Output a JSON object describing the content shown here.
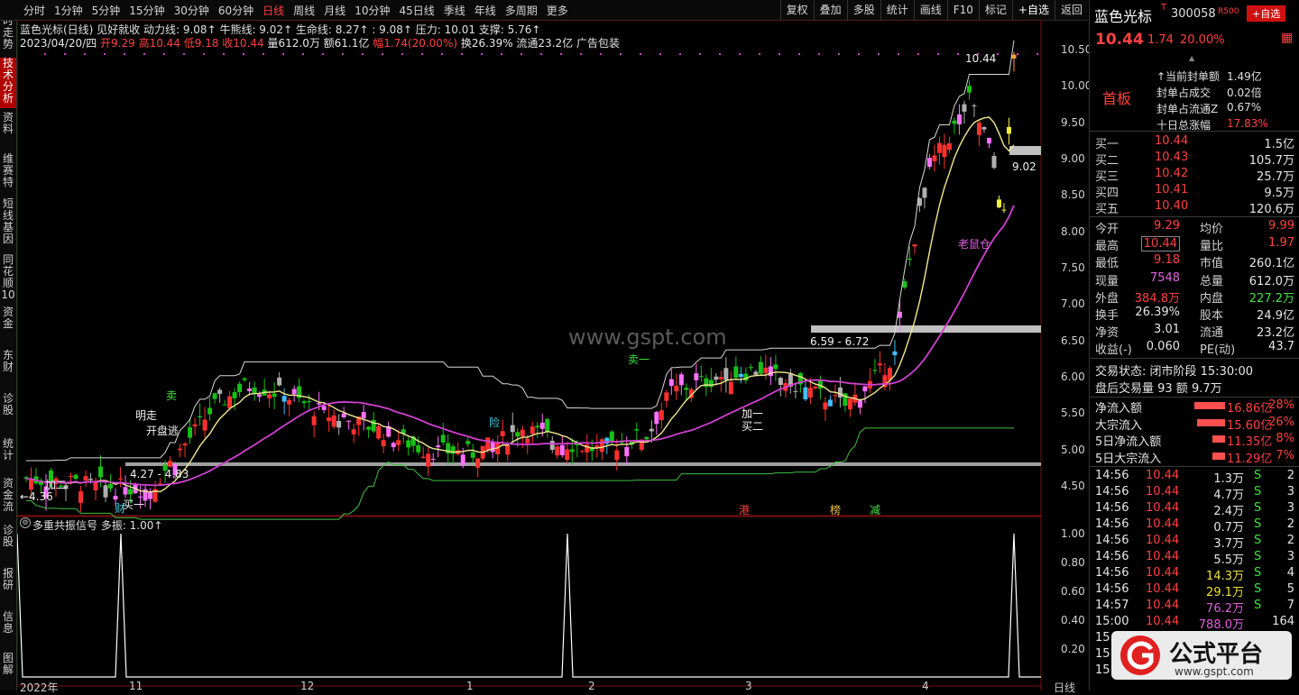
{
  "toolbar": {
    "periods": [
      "分时",
      "1分钟",
      "5分钟",
      "15分钟",
      "30分钟",
      "60分钟",
      "日线",
      "周线",
      "月线",
      "10分钟",
      "45日线",
      "季线",
      "年线",
      "多周期",
      "更多"
    ],
    "active_period": "日线",
    "right_buttons": [
      "复权",
      "叠加",
      "多股",
      "统计",
      "画线",
      "F10",
      "标记",
      "+自选",
      "返回"
    ]
  },
  "left_tabs": [
    "分时走势",
    "技术分析",
    "资料",
    "维赛特",
    "短线基因",
    "同花顺10",
    "资金",
    "东财",
    "诊股",
    "统计",
    "资金流",
    "诊股",
    "报研",
    "信息",
    "图解"
  ],
  "info": {
    "line1": "蓝色光标(日线)  见好就收  动力线: 9.08↑  牛熊线: 9.02↑  生命线: 8.27↑  : 9.08↑  压力: 10.01  支撑: 5.76↑",
    "line2_parts": [
      {
        "t": "2023/04/20/四",
        "c": "wht"
      },
      {
        "t": " 开9.29",
        "c": "red"
      },
      {
        "t": " 高10.44",
        "c": "red"
      },
      {
        "t": " 低9.18",
        "c": "red"
      },
      {
        "t": " 收10.44",
        "c": "red"
      },
      {
        "t": " 量612.0万",
        "c": "wht"
      },
      {
        "t": " 额61.1亿",
        "c": "wht"
      },
      {
        "t": " 幅1.74(20.00%)",
        "c": "red"
      },
      {
        "t": " 换26.39%",
        "c": "wht"
      },
      {
        "t": " 流通23.2亿",
        "c": "wht"
      },
      {
        "t": " 广告包装",
        "c": "wht"
      }
    ],
    "indicator2": "多重共振信号  多振: 1.00↑"
  },
  "y_axis_main": [
    "10.50",
    "10.00",
    "9.50",
    "9.00",
    "8.50",
    "8.00",
    "7.50",
    "7.00",
    "6.50",
    "6.00",
    "5.50",
    "5.00",
    "4.50"
  ],
  "y_axis_sub": [
    "1.00",
    "0.80",
    "0.60",
    "0.40",
    "0.20"
  ],
  "x_axis": [
    "2022年",
    "11",
    "12",
    "1",
    "2",
    "3",
    "4"
  ],
  "x_axis_end": "日线",
  "watermark": "www.gspt.com",
  "annotations": [
    {
      "t": "10.44",
      "c": "wht"
    },
    {
      "t": "9.02",
      "c": "wht"
    },
    {
      "t": "6.59 - 6.72",
      "c": "wht"
    },
    {
      "t": "4.27 - 4.83",
      "c": "wht"
    },
    {
      "t": "←4.36",
      "c": "wht"
    },
    {
      "t": "明走",
      "c": "wht"
    },
    {
      "t": "开盘逃",
      "c": "wht"
    },
    {
      "t": "加二",
      "c": "wht"
    },
    {
      "t": "买一",
      "c": "wht"
    },
    {
      "t": "买二",
      "c": "wht"
    },
    {
      "t": "卖",
      "c": "grn"
    },
    {
      "t": "卖一",
      "c": "grn"
    },
    {
      "t": "险",
      "c": "cyn"
    },
    {
      "t": "加一",
      "c": "wht"
    },
    {
      "t": "老鼠仓",
      "c": "mag"
    },
    {
      "t": "财",
      "c": "cyn"
    },
    {
      "t": "港",
      "c": "red"
    },
    {
      "t": "榜",
      "c": "yel"
    },
    {
      "t": "减",
      "c": "grn"
    }
  ],
  "right_panel": {
    "name": "蓝色光标",
    "tag": "T",
    "code": "300058",
    "r_badge": "R500",
    "add_btn": "+自选",
    "price": "10.44",
    "change": "1.74",
    "pct": "20.00%",
    "board": "首板",
    "seal": [
      {
        "l": "↑当前封单额",
        "v": "1.49亿"
      },
      {
        "l": "封单占成交",
        "v": "0.02倍"
      },
      {
        "l": "封单占流通Z",
        "v": "0.67%"
      },
      {
        "l": "十日总涨幅",
        "v": "17.83%"
      }
    ],
    "bids": [
      {
        "l": "买一",
        "p": "10.44",
        "v": "1.5亿"
      },
      {
        "l": "买二",
        "p": "10.43",
        "v": "105.7万"
      },
      {
        "l": "买三",
        "p": "10.42",
        "v": "25.7万"
      },
      {
        "l": "买四",
        "p": "10.41",
        "v": "9.5万"
      },
      {
        "l": "买五",
        "p": "10.40",
        "v": "120.6万"
      }
    ],
    "stats": [
      {
        "l1": "今开",
        "v1": "9.29",
        "c1": "red",
        "l2": "均价",
        "v2": "9.99",
        "c2": "red"
      },
      {
        "l1": "最高",
        "v1": "10.44",
        "c1": "red",
        "l2": "量比",
        "v2": "1.97",
        "c2": "red"
      },
      {
        "l1": "最低",
        "v1": "9.18",
        "c1": "red",
        "l2": "市值",
        "v2": "260.1亿",
        "c2": "wht"
      },
      {
        "l1": "现量",
        "v1": "7548",
        "c1": "mag",
        "l2": "总量",
        "v2": "612.0万",
        "c2": "wht"
      },
      {
        "l1": "外盘",
        "v1": "384.8万",
        "c1": "red",
        "l2": "内盘",
        "v2": "227.2万",
        "c2": "grn"
      },
      {
        "l1": "换手",
        "v1": "26.39%",
        "c1": "wht",
        "l2": "股本",
        "v2": "24.9亿",
        "c2": "wht"
      },
      {
        "l1": "净资",
        "v1": "3.01",
        "c1": "wht",
        "l2": "流通",
        "v2": "23.2亿",
        "c2": "wht"
      },
      {
        "l1": "收益(-)",
        "v1": "0.060",
        "c1": "wht",
        "l2": "PE(动)",
        "v2": "43.7",
        "c2": "wht"
      }
    ],
    "trade_status": "交易状态: 闭市阶段 15:30:00",
    "after_hours": "盘后交易量 93 额 9.7万",
    "flows": [
      {
        "l": "净流入额",
        "v": "16.86亿",
        "p": "28%",
        "bar": 0.28
      },
      {
        "l": "大宗流入",
        "v": "15.60亿",
        "p": "26%",
        "bar": 0.26
      },
      {
        "l": "5日净流入额",
        "v": "11.35亿",
        "p": "8%",
        "bar": 0.08
      },
      {
        "l": "5日大宗流入",
        "v": "11.29亿",
        "p": "7%",
        "bar": 0.07
      }
    ],
    "ticks": [
      {
        "t": "14:56",
        "p": "10.44",
        "v": "1.3万",
        "s": "S",
        "n": "2",
        "vc": "wht"
      },
      {
        "t": "14:56",
        "p": "10.44",
        "v": "4.7万",
        "s": "S",
        "n": "3",
        "vc": "wht"
      },
      {
        "t": "14:56",
        "p": "10.44",
        "v": "2.4万",
        "s": "S",
        "n": "3",
        "vc": "wht"
      },
      {
        "t": "14:56",
        "p": "10.44",
        "v": "0.7万",
        "s": "S",
        "n": "2",
        "vc": "wht"
      },
      {
        "t": "14:56",
        "p": "10.44",
        "v": "3.7万",
        "s": "S",
        "n": "2",
        "vc": "wht"
      },
      {
        "t": "14:56",
        "p": "10.44",
        "v": "5.5万",
        "s": "S",
        "n": "3",
        "vc": "wht"
      },
      {
        "t": "14:56",
        "p": "10.44",
        "v": "14.3万",
        "s": "S",
        "n": "4",
        "vc": "yel"
      },
      {
        "t": "14:56",
        "p": "10.44",
        "v": "29.1万",
        "s": "S",
        "n": "5",
        "vc": "yel"
      },
      {
        "t": "14:57",
        "p": "10.44",
        "v": "76.2万",
        "s": "S",
        "n": "7",
        "vc": "mag"
      },
      {
        "t": "15:00",
        "p": "10.44",
        "v": "788.0万",
        "s": "",
        "n": "164",
        "vc": "mag"
      },
      {
        "t": "15",
        "p": "",
        "v": "",
        "s": "",
        "n": "",
        "vc": "wht"
      },
      {
        "t": "15",
        "p": "",
        "v": "",
        "s": "",
        "n": "",
        "vc": "wht"
      },
      {
        "t": "15",
        "p": "",
        "v": "",
        "s": "",
        "n": "",
        "vc": "wht"
      }
    ]
  },
  "logo": {
    "brand": "公式平台",
    "url": "www.gspt.com"
  },
  "colors": {
    "up": "#ff3030",
    "down": "#18c018",
    "bg": "#000000",
    "accent": "#ff4040",
    "magenta": "#e040e0",
    "yellow": "#f0e890",
    "cyan": "#40d0ff",
    "pink": "#ff60ff"
  }
}
